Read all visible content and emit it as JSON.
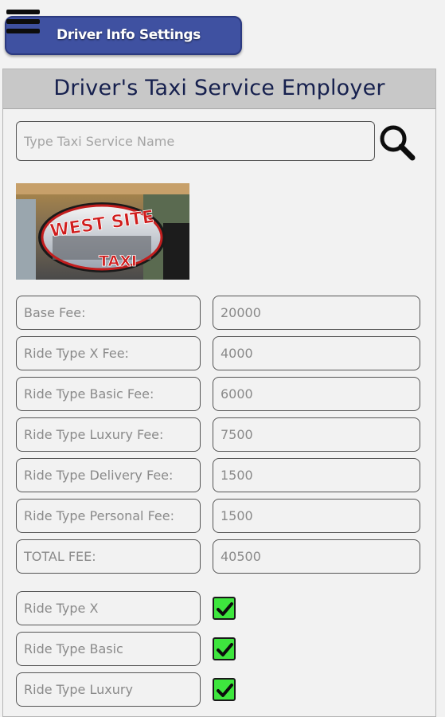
{
  "header": {
    "menu_icon": "hamburger-menu-icon",
    "title": "Driver Info Settings",
    "accent_color": "#3f51a1"
  },
  "panel": {
    "title": "Driver's Taxi Service Employer"
  },
  "search": {
    "placeholder": "Type Taxi Service Name",
    "value": "",
    "icon": "search-icon"
  },
  "logo": {
    "text_top": "WEST SITE",
    "text_bottom": "TAXI"
  },
  "fees": [
    {
      "label": "Base Fee:",
      "value": "20000"
    },
    {
      "label": "Ride Type X Fee:",
      "value": "4000"
    },
    {
      "label": "Ride Type Basic Fee:",
      "value": "6000"
    },
    {
      "label": "Ride Type Luxury Fee:",
      "value": "7500"
    },
    {
      "label": "Ride Type Delivery Fee:",
      "value": "1500"
    },
    {
      "label": "Ride Type Personal Fee:",
      "value": "1500"
    },
    {
      "label": "TOTAL FEE:",
      "value": "40500"
    }
  ],
  "ride_types": [
    {
      "label": "Ride Type X",
      "checked": true
    },
    {
      "label": "Ride Type Basic",
      "checked": true
    },
    {
      "label": "Ride Type Luxury",
      "checked": true
    }
  ],
  "colors": {
    "checkbox_fill": "#3ee63e",
    "panel_header_text": "#16204e"
  }
}
